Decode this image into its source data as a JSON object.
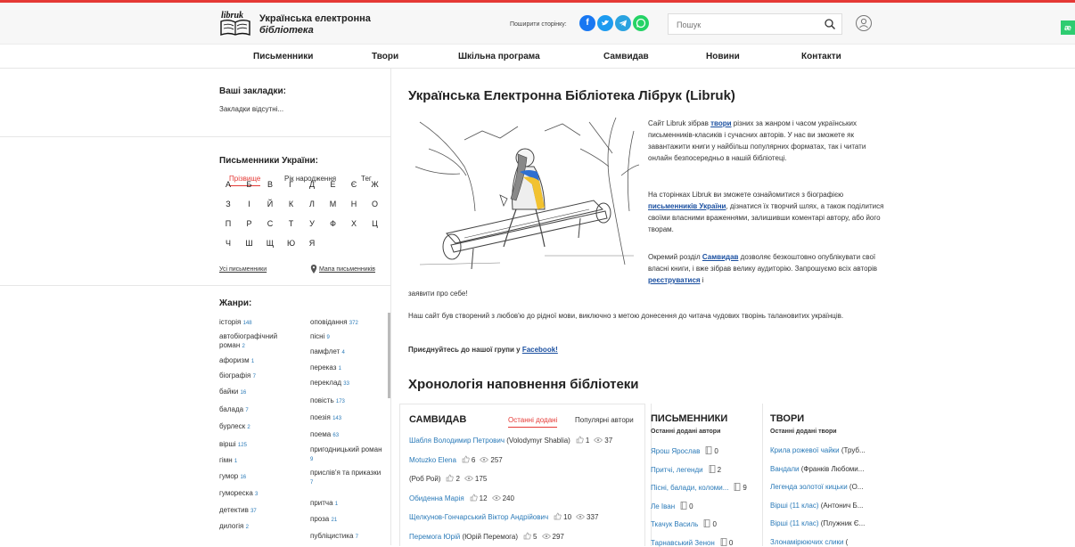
{
  "header": {
    "logo_mark": "libruk",
    "logo_line1": "Українська електронна",
    "logo_line2": "бібліотека",
    "share_label": "Поширити сторінку:",
    "search_placeholder": "Пошук",
    "ae_badge": "æ"
  },
  "nav": [
    "Письменники",
    "Твори",
    "Шкільна програма",
    "Самвидав",
    "Новини",
    "Контакти"
  ],
  "bookmarks": {
    "title": "Ваші закладки:",
    "empty": "Закладки відсутні..."
  },
  "writers": {
    "title": "Письменники України:",
    "tabs": [
      "Прізвище",
      "Рік народження",
      "Тег"
    ],
    "letters": [
      [
        "А",
        "Б",
        "В",
        "Г",
        "Д",
        "Е",
        "Є",
        "Ж"
      ],
      [
        "З",
        "І",
        "Й",
        "К",
        "Л",
        "М",
        "Н",
        "О"
      ],
      [
        "П",
        "Р",
        "С",
        "Т",
        "У",
        "Ф",
        "Х",
        "Ц"
      ],
      [
        "Ч",
        "Ш",
        "Щ",
        "Ю",
        "Я"
      ]
    ],
    "all_link": "Усі письменники",
    "map_link": "Мапа письменників"
  },
  "genres": {
    "title": "Жанри:",
    "left": [
      {
        "name": "історія",
        "count": "148"
      },
      {
        "name": "автобіографічний роман",
        "count": "2"
      },
      {
        "name": "афоризм",
        "count": "1"
      },
      {
        "name": "біографія",
        "count": "7"
      },
      {
        "name": "байки",
        "count": "16"
      },
      {
        "name": "балада",
        "count": "7"
      },
      {
        "name": "бурлеск",
        "count": "2"
      },
      {
        "name": "вірші",
        "count": "125"
      },
      {
        "name": "гімн",
        "count": "1"
      },
      {
        "name": "гумор",
        "count": "16"
      },
      {
        "name": "гумореска",
        "count": "3"
      },
      {
        "name": "детектив",
        "count": "37"
      },
      {
        "name": "дилогія",
        "count": "2"
      }
    ],
    "right": [
      {
        "name": "оповідання",
        "count": "372"
      },
      {
        "name": "пісні",
        "count": "9"
      },
      {
        "name": "памфлет",
        "count": "4"
      },
      {
        "name": "переказ",
        "count": "1"
      },
      {
        "name": "переклад",
        "count": "33"
      },
      {
        "name": "повість",
        "count": "173"
      },
      {
        "name": "поезія",
        "count": "143"
      },
      {
        "name": "поема",
        "count": "63"
      },
      {
        "name": "пригодницький роман",
        "count": "9"
      },
      {
        "name": "прислів'я та приказки",
        "count": "7"
      },
      {
        "name": "притча",
        "count": "1"
      },
      {
        "name": "проза",
        "count": "21"
      },
      {
        "name": "публіцистика",
        "count": "7"
      }
    ]
  },
  "main": {
    "title": "Українська Електронна Бібліотека Лібрук (Libruk)",
    "p1_a": "Сайт Libruk зібрав ",
    "p1_link": "твори",
    "p1_b": " різних за жанром і часом українських письменників-класиків і сучасних авторів. У нас ви зможете як завантажити книги у найбільш популярних форматах, так і читати онлайн безпосередньо в нашій бібліотеці.",
    "p2_a": "На сторінках Libruk ви зможете ознайомитися з біографією ",
    "p2_link": "письменників України",
    "p2_b": ", дізнатися їх творчий шлях, а також поділитися своїми власними враженнями, залишивши коментарі автору, або його творам.",
    "p3_a": "Окремий розділ ",
    "p3_link": "Самвидав",
    "p3_b": " дозволяє безкоштовно опублікувати свої власні книги, і вже зібрав велику аудиторію. Запрошуємо всіх авторів ",
    "p3_link2": "реєструватися",
    "p3_c": " і",
    "p3_end": "заявити про себе!",
    "p4": "Наш сайт був створений з любов'ю до рідної мови, виключно з метою донесення до читача чудових творінь талановитих українців.",
    "p5_a": "Приєднуйтесь до нашої групи у ",
    "p5_link": "Facebook!",
    "chron_title": "Хронологія наповнення бібліотеки"
  },
  "samvydav": {
    "title": "САМВИДАВ",
    "tabs": [
      "Останні додані",
      "Популярні автори"
    ],
    "entries": [
      {
        "author": "Шабля Володимир Петрович",
        "alias": " (Volodymyr Shablia)",
        "likes": "1",
        "views": "37"
      },
      {
        "author": "Motuzko Elena",
        "alias": "",
        "likes": "6",
        "views": "257"
      },
      {
        "author": "",
        "alias": "(Роб Рой)",
        "likes": "2",
        "views": "175"
      },
      {
        "author": "Обиденна Марія",
        "alias": "",
        "likes": "12",
        "views": "240"
      },
      {
        "author": "Щелкунов-Гончарський Віктор Андрійович",
        "alias": "",
        "likes": "10",
        "views": "337"
      },
      {
        "author": "Перемога Юрій",
        "alias": " (Юрій Перемога)",
        "likes": "5",
        "views": "297"
      }
    ]
  },
  "writers_col": {
    "title": "ПИСЬМЕННИКИ",
    "subtitle": "Останні додані автори",
    "items": [
      {
        "name": "Ярош Ярослав",
        "count": "0"
      },
      {
        "name": "Притчі, легенди",
        "count": "2"
      },
      {
        "name": "Пісні, балади, коломи...",
        "count": "9"
      },
      {
        "name": "Ле Іван",
        "count": "0"
      },
      {
        "name": "Ткачук Василь",
        "count": "0"
      },
      {
        "name": "Тарнавський Зенон",
        "count": "0"
      }
    ]
  },
  "works_col": {
    "title": "ТВОРИ",
    "subtitle": "Останні додані твори",
    "items": [
      {
        "title": "Крила рожевої чайки",
        "author": " (Труб..."
      },
      {
        "title": "Вандали",
        "author": " (Франків Любоми..."
      },
      {
        "title": "Легенда золотої кицьки",
        "author": " (О..."
      },
      {
        "title": "Вірші (11 клас)",
        "author": " (Антонич Б..."
      },
      {
        "title": "Вірші (11 клас)",
        "author": " (Плужник Є..."
      },
      {
        "title": "Злонамірюючих слики",
        "author": " ("
      }
    ]
  },
  "colors": {
    "accent": "#e53935",
    "link": "#2a7ab8"
  }
}
